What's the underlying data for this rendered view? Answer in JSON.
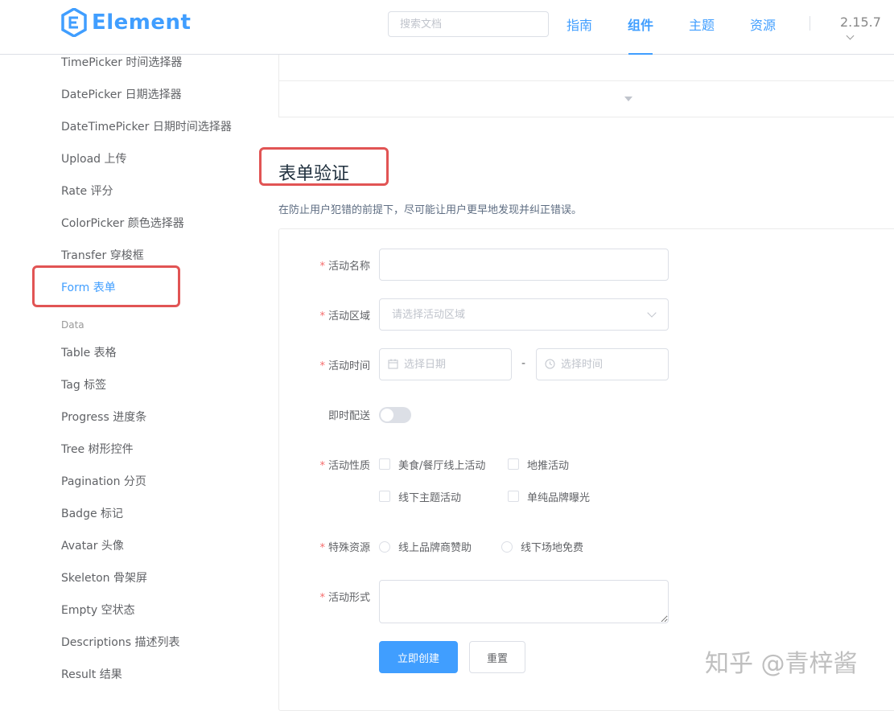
{
  "header": {
    "logo_text": "Element",
    "search_placeholder": "搜索文档",
    "nav": [
      {
        "label": "指南"
      },
      {
        "label": "组件"
      },
      {
        "label": "主题"
      },
      {
        "label": "资源"
      }
    ],
    "version": "2.15.7"
  },
  "sidebar": {
    "items": [
      "TimePicker 时间选择器",
      "DatePicker 日期选择器",
      "DateTimePicker 日期时间选择器",
      "Upload 上传",
      "Rate 评分",
      "ColorPicker 颜色选择器",
      "Transfer 穿梭框",
      "Form 表单"
    ],
    "group": "Data",
    "data_items": [
      "Table 表格",
      "Tag 标签",
      "Progress 进度条",
      "Tree 树形控件",
      "Pagination 分页",
      "Badge 标记",
      "Avatar 头像",
      "Skeleton 骨架屏",
      "Empty 空状态",
      "Descriptions 描述列表",
      "Result 结果"
    ]
  },
  "main": {
    "title": "表单验证",
    "desc": "在防止用户犯错的前提下，尽可能让用户更早地发现并纠正错误。"
  },
  "form": {
    "required_mark": "*",
    "name_label": "活动名称",
    "region_label": "活动区域",
    "region_placeholder": "请选择活动区域",
    "time_label": "活动时间",
    "date_placeholder": "选择日期",
    "time_dash": "-",
    "time_placeholder": "选择时间",
    "delivery_label": "即时配送",
    "type_label": "活动性质",
    "types": [
      "美食/餐厅线上活动",
      "地推活动",
      "线下主题活动",
      "单纯品牌曝光"
    ],
    "resource_label": "特殊资源",
    "resources": [
      "线上品牌商赞助",
      "线下场地免费"
    ],
    "desc_label": "活动形式",
    "submit_label": "立即创建",
    "reset_label": "重置"
  },
  "watermark": "知乎 @青梓酱",
  "colors": {
    "accent": "#409eff",
    "highlight_box": "#e15454",
    "required": "#f56c6c"
  }
}
